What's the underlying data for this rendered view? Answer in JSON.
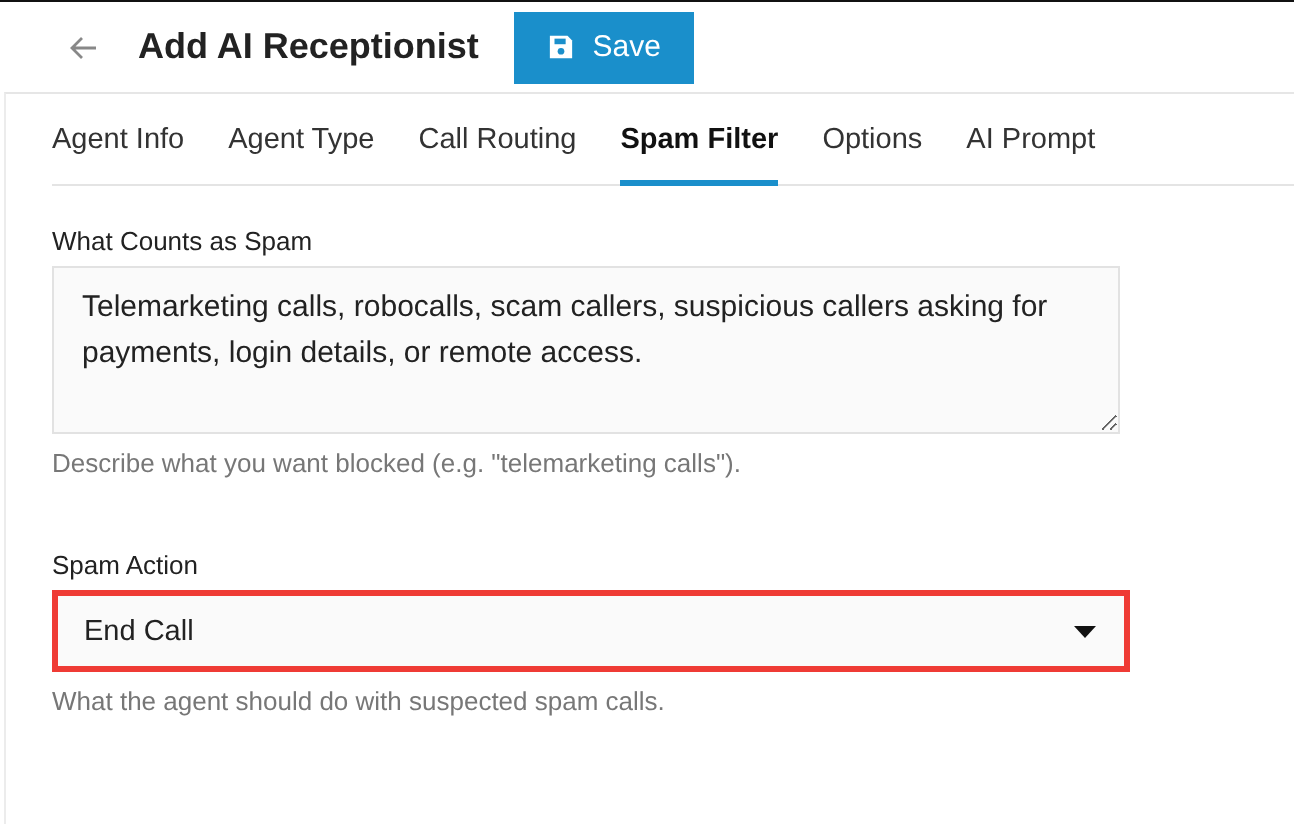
{
  "header": {
    "title": "Add AI Receptionist",
    "save_button": "Save"
  },
  "tabs": [
    {
      "label": "Agent Info",
      "selected": false
    },
    {
      "label": "Agent Type",
      "selected": false
    },
    {
      "label": "Call Routing",
      "selected": false
    },
    {
      "label": "Spam Filter",
      "selected": true
    },
    {
      "label": "Options",
      "selected": false
    },
    {
      "label": "AI Prompt",
      "selected": false
    }
  ],
  "spam_description": {
    "label": "What Counts as Spam",
    "value": "Telemarketing calls, robocalls, scam callers, suspicious callers asking for payments, login details, or remote access.",
    "help": "Describe what you want blocked (e.g. \"telemarketing calls\")."
  },
  "spam_action": {
    "label": "Spam Action",
    "value": "End Call",
    "help": "What the agent should do with suspected spam calls.",
    "highlighted": true
  }
}
